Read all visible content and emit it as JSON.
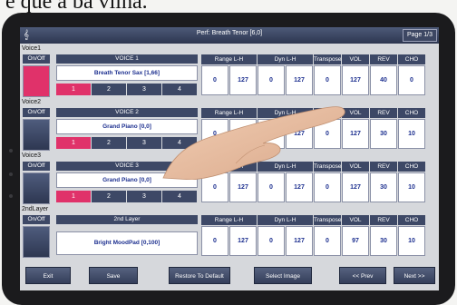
{
  "caption": "e que a ba vilha.",
  "header": {
    "title": "Perf: Breath Tenor [6,0]",
    "page": "Page 1/3",
    "tuner_glyph": "𝄞"
  },
  "colors": {
    "header_bg": "#3d4866",
    "value_text": "#1c2f8f",
    "selected_seg": "#e0326a",
    "seg_bg": "#3d4866",
    "active_voice": "#e0326a"
  },
  "voices": [
    {
      "label": "Voice1",
      "onoff": "On/Off",
      "header": "VOICE 1",
      "name": "Breath Tenor Sax [1,66]",
      "segments": [
        "1",
        "2",
        "3",
        "4"
      ],
      "selected_segment": 0,
      "active": true,
      "params": [
        "0",
        "127",
        "0",
        "127",
        "0",
        "127",
        "40",
        "0"
      ]
    },
    {
      "label": "Voice2",
      "onoff": "On/Off",
      "header": "VOICE 2",
      "name": "Grand Piano [0,0]",
      "segments": [
        "1",
        "2",
        "3",
        "4"
      ],
      "selected_segment": 0,
      "active": false,
      "params": [
        "0",
        "127",
        "0",
        "127",
        "0",
        "127",
        "30",
        "10"
      ]
    },
    {
      "label": "Voice3",
      "onoff": "On/Off",
      "header": "VOICE 3",
      "name": "Grand Piano [0,0]",
      "segments": [
        "1",
        "2",
        "3",
        "4"
      ],
      "selected_segment": 0,
      "active": false,
      "params": [
        "0",
        "127",
        "0",
        "127",
        "0",
        "127",
        "30",
        "10"
      ]
    },
    {
      "label": "2ndLayer",
      "onoff": "On/Off",
      "header": "2nd Layer",
      "name": "Bright MoodPad [0,100]",
      "segments": [],
      "active": false,
      "params": [
        "0",
        "127",
        "0",
        "127",
        "0",
        "97",
        "30",
        "10"
      ]
    }
  ],
  "param_headers": [
    "Range L-H",
    "Dyn L-H",
    "Transposer",
    "VOL",
    "REV",
    "CHO"
  ],
  "buttons": [
    "Exit",
    "Save",
    "Restore To Default",
    "Select Image",
    "<< Prev",
    "Next >>"
  ]
}
